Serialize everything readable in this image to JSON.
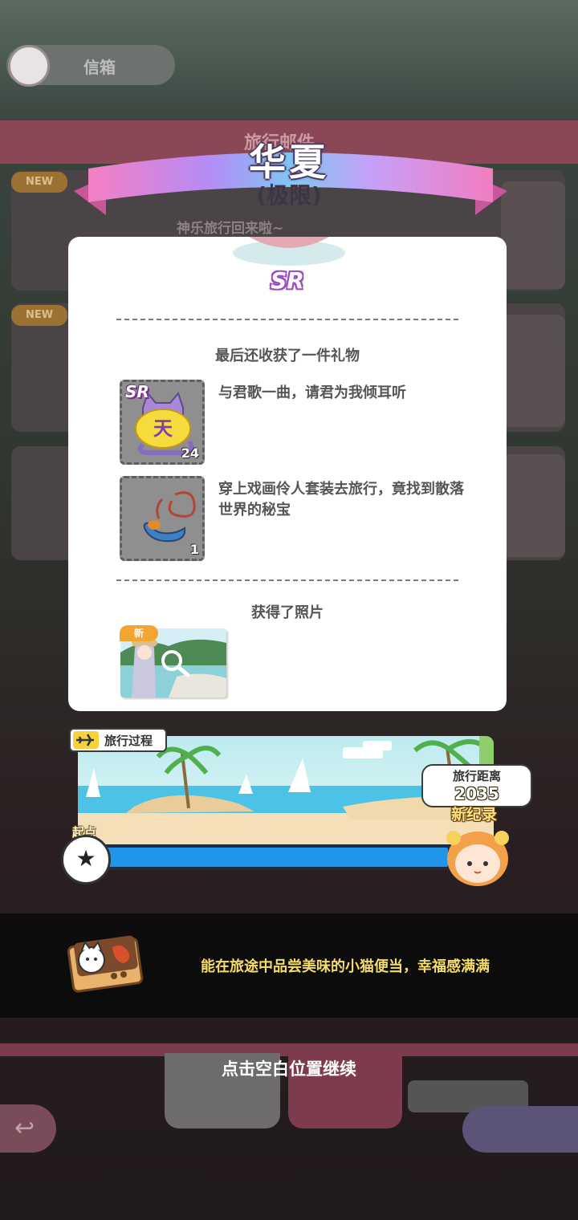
{
  "background": {
    "mail_label": "信箱",
    "section_title": "旅行邮件",
    "letter_preview": "神乐旅行回来啦~",
    "new_tag": "NEW"
  },
  "header": {
    "title": "华夏",
    "subtitle": "(极限)"
  },
  "panel": {
    "rarity": "SR",
    "gift_section_title": "最后还收获了一件礼物",
    "items": [
      {
        "rarity": "SR",
        "count": "24",
        "description": "与君歌一曲，请君为我倾耳听",
        "icon": "yellow-shirt-item-icon"
      },
      {
        "count": "1",
        "description": "穿上戏画伶人套装去旅行，竟找到散落世界的秘宝",
        "icon": "jade-pendant-item-icon"
      }
    ],
    "photo_section_title": "获得了照片",
    "photo": {
      "new_badge": "新",
      "icon": "magnifier-icon"
    }
  },
  "travel": {
    "tag_label": "旅行过程",
    "start_label": "起点",
    "start_icon": "★",
    "distance_label": "旅行距离",
    "distance_value": "2035",
    "record_label": "新纪录",
    "progress": 0.96
  },
  "info": {
    "message": "能在旅途中品尝美味的小猫便当，幸福感满满"
  },
  "hint": {
    "continue": "点击空白位置继续"
  },
  "colors": {
    "ribbon_gradient": [
      "#f47fc4",
      "#b58cf5",
      "#7fc6f4",
      "#c6a0f8",
      "#f17dc0"
    ],
    "progress": "#2196e8",
    "info_text": "#f4dd6a"
  }
}
